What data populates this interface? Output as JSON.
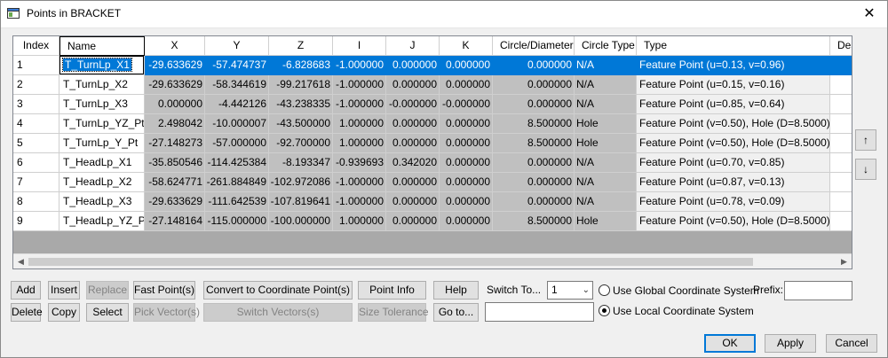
{
  "window": {
    "title": "Points in BRACKET",
    "close_glyph": "✕"
  },
  "columns": [
    "Index",
    "Name",
    "X",
    "Y",
    "Z",
    "I",
    "J",
    "K",
    "Circle/Diameter",
    "Circle Type",
    "Type",
    "Des"
  ],
  "rows": [
    {
      "index": "1",
      "name": "T_TurnLp_X1",
      "x": "-29.633629",
      "y": "-57.474737",
      "z": "-6.828683",
      "i": "-1.000000",
      "j": "0.000000",
      "k": "0.000000",
      "diam": "0.000000",
      "ctype": "N/A",
      "type": "Feature Point (u=0.13, v=0.96)"
    },
    {
      "index": "2",
      "name": "T_TurnLp_X2",
      "x": "-29.633629",
      "y": "-58.344619",
      "z": "-99.217618",
      "i": "-1.000000",
      "j": "0.000000",
      "k": "0.000000",
      "diam": "0.000000",
      "ctype": "N/A",
      "type": "Feature Point (u=0.15, v=0.16)"
    },
    {
      "index": "3",
      "name": "T_TurnLp_X3",
      "x": "0.000000",
      "y": "-4.442126",
      "z": "-43.238335",
      "i": "-1.000000",
      "j": "-0.000000",
      "k": "-0.000000",
      "diam": "0.000000",
      "ctype": "N/A",
      "type": "Feature Point (u=0.85, v=0.64)"
    },
    {
      "index": "4",
      "name": "T_TurnLp_YZ_Pt",
      "x": "2.498042",
      "y": "-10.000007",
      "z": "-43.500000",
      "i": "1.000000",
      "j": "0.000000",
      "k": "0.000000",
      "diam": "8.500000",
      "ctype": "Hole",
      "type": "Feature Point (v=0.50), Hole (D=8.5000)"
    },
    {
      "index": "5",
      "name": "T_TurnLp_Y_Pt",
      "x": "-27.148273",
      "y": "-57.000000",
      "z": "-92.700000",
      "i": "1.000000",
      "j": "0.000000",
      "k": "0.000000",
      "diam": "8.500000",
      "ctype": "Hole",
      "type": "Feature Point (v=0.50), Hole (D=8.5000)"
    },
    {
      "index": "6",
      "name": "T_HeadLp_X1",
      "x": "-35.850546",
      "y": "-114.425384",
      "z": "-8.193347",
      "i": "-0.939693",
      "j": "0.342020",
      "k": "0.000000",
      "diam": "0.000000",
      "ctype": "N/A",
      "type": "Feature Point (u=0.70, v=0.85)"
    },
    {
      "index": "7",
      "name": "T_HeadLp_X2",
      "x": "-58.624771",
      "y": "-261.884849",
      "z": "-102.972086",
      "i": "-1.000000",
      "j": "0.000000",
      "k": "0.000000",
      "diam": "0.000000",
      "ctype": "N/A",
      "type": "Feature Point (u=0.87, v=0.13)"
    },
    {
      "index": "8",
      "name": "T_HeadLp_X3",
      "x": "-29.633629",
      "y": "-111.642539",
      "z": "-107.819641",
      "i": "-1.000000",
      "j": "0.000000",
      "k": "0.000000",
      "diam": "0.000000",
      "ctype": "N/A",
      "type": "Feature Point (u=0.78, v=0.09)"
    },
    {
      "index": "9",
      "name": "T_HeadLp_YZ_Pt",
      "x": "-27.148164",
      "y": "-115.000000",
      "z": "-100.000000",
      "i": "1.000000",
      "j": "0.000000",
      "k": "0.000000",
      "diam": "8.500000",
      "ctype": "Hole",
      "type": "Feature Point (v=0.50), Hole (D=8.5000)"
    }
  ],
  "selected_row": 0,
  "side": {
    "up": "↑",
    "down": "↓"
  },
  "buttons": {
    "add": "Add",
    "insert": "Insert",
    "replace": "Replace",
    "fast_point": "Fast Point(s)",
    "convert": "Convert to Coordinate Point(s)",
    "point_info": "Point Info",
    "help": "Help",
    "delete": "Delete",
    "copy": "Copy",
    "select": "Select",
    "pick_vector": "Pick Vector(s)",
    "switch_vectors": "Switch Vectors(s)",
    "size_tolerance": "Size Tolerance",
    "goto": "Go to...",
    "ok": "OK",
    "apply": "Apply",
    "cancel": "Cancel"
  },
  "switch_to": {
    "label": "Switch To...",
    "value": "1"
  },
  "coord": {
    "global": "Use Global Coordinate System",
    "local": "Use Local Coordinate System",
    "selected": "local"
  },
  "prefix": {
    "label": "Prefix:",
    "value": ""
  },
  "goto_value": ""
}
